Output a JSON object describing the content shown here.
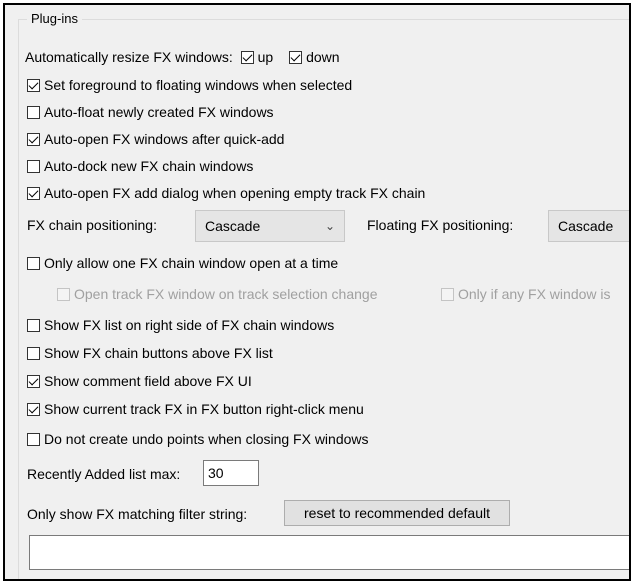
{
  "group": {
    "title": "Plug-ins"
  },
  "resize": {
    "label": "Automatically resize FX windows:",
    "up": {
      "label": "up",
      "checked": true
    },
    "down": {
      "label": "down",
      "checked": true
    }
  },
  "options": [
    {
      "label": "Set foreground to floating windows when selected",
      "checked": true
    },
    {
      "label": "Auto-float newly created FX windows",
      "checked": false
    },
    {
      "label": "Auto-open FX windows after quick-add",
      "checked": true
    },
    {
      "label": "Auto-dock new FX chain windows",
      "checked": false
    },
    {
      "label": "Auto-open FX add dialog when opening empty track FX chain",
      "checked": true
    }
  ],
  "positioning": {
    "chain_label": "FX chain positioning:",
    "chain_value": "Cascade",
    "floating_label": "Floating FX positioning:",
    "floating_value": "Cascade"
  },
  "one_window": {
    "label": "Only allow one FX chain window open at a time",
    "checked": false,
    "sub_open_track": {
      "label": "Open track FX window on track selection change",
      "checked": false
    },
    "sub_only_if": {
      "label": "Only if any FX window is",
      "checked": false
    }
  },
  "options2": [
    {
      "label": "Show FX list on right side of FX chain windows",
      "checked": false
    },
    {
      "label": "Show FX chain buttons above FX list",
      "checked": false
    },
    {
      "label": "Show comment field above FX UI",
      "checked": true
    },
    {
      "label": "Show current track FX in FX button right-click menu",
      "checked": true
    },
    {
      "label": "Do not create undo points when closing FX windows",
      "checked": false
    }
  ],
  "recent": {
    "label": "Recently Added list max:",
    "value": "30"
  },
  "filter": {
    "label": "Only show FX matching filter string:",
    "reset_label": "reset to recommended default",
    "value": ""
  }
}
